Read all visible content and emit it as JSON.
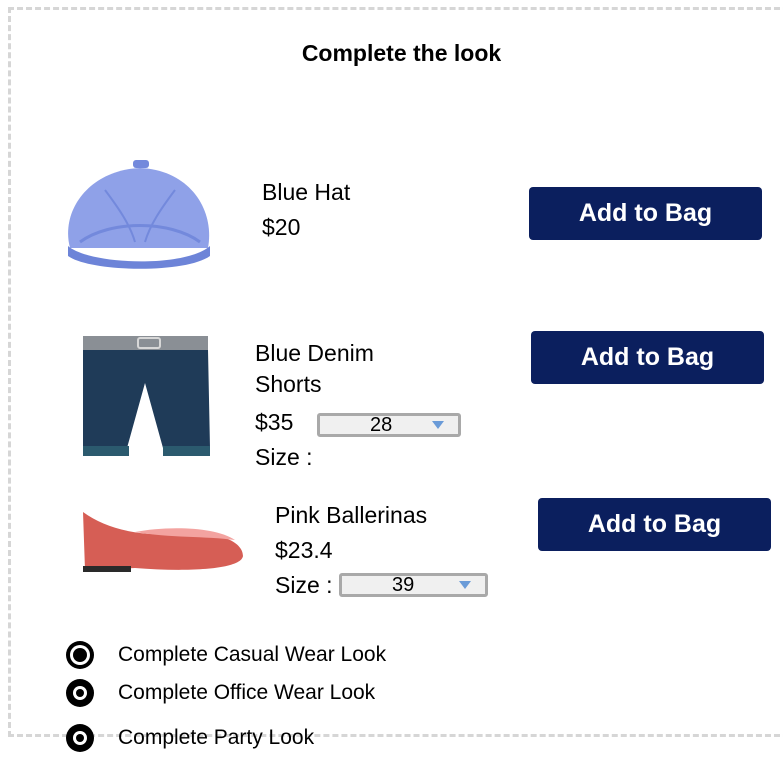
{
  "title": "Complete the look",
  "products": [
    {
      "name": "Blue Hat",
      "price": "$20",
      "button": "Add to Bag"
    },
    {
      "name": "Blue Denim Shorts",
      "price": "$35",
      "size_label": "Size :",
      "size_value": "28",
      "button": "Add to Bag"
    },
    {
      "name": "Pink Ballerinas",
      "price": "$23.4",
      "size_label": "Size :",
      "size_value": "39",
      "button": "Add to Bag"
    }
  ],
  "looks": [
    {
      "label": "Complete Casual Wear Look",
      "selected": true
    },
    {
      "label": "Complete Office Wear Look",
      "selected": false
    },
    {
      "label": "Complete Party Look",
      "selected": false
    }
  ]
}
